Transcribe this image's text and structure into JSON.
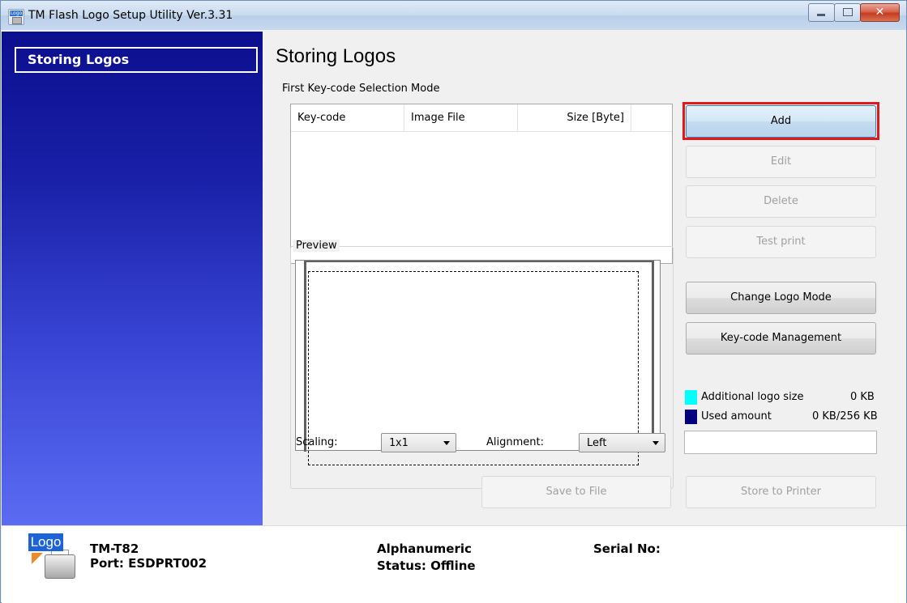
{
  "window": {
    "title": "TM Flash Logo Setup Utility Ver.3.31",
    "icon_text": "Logo"
  },
  "sidebar": {
    "items": [
      {
        "label": "Storing Logos",
        "selected": true
      }
    ]
  },
  "main": {
    "heading": "Storing Logos",
    "mode_label": "First Key-code Selection Mode",
    "list": {
      "columns": [
        "Key-code",
        "Image File",
        "Size [Byte]"
      ],
      "rows": []
    },
    "preview": {
      "label": "Preview",
      "scaling_label": "Scaling:",
      "scaling_value": "1x1",
      "alignment_label": "Alignment:",
      "alignment_value": "Left"
    },
    "buttons": {
      "add": "Add",
      "edit": "Edit",
      "delete": "Delete",
      "test_print": "Test print",
      "change_logo_mode": "Change Logo Mode",
      "keycode_management": "Key-code Management",
      "save_to_file": "Save to File",
      "store_to_printer": "Store to Printer"
    },
    "capacity": {
      "additional_label": "Additional logo size",
      "additional_value": "0 KB",
      "additional_color": "#00ffff",
      "used_label": "Used amount",
      "used_value": "0 KB/256 KB",
      "used_color": "#00007f",
      "used_fraction": 0
    }
  },
  "status": {
    "logo_text": "Logo",
    "model": "TM-T82",
    "port": "Port: ESDPRT002",
    "font": "Alphanumeric",
    "state": "Status: Offline",
    "serial": "Serial No:"
  },
  "colors": {
    "highlight": "#e0191f",
    "sidebar_top": "#0b0f8e",
    "sidebar_bottom": "#5b6cf2"
  }
}
